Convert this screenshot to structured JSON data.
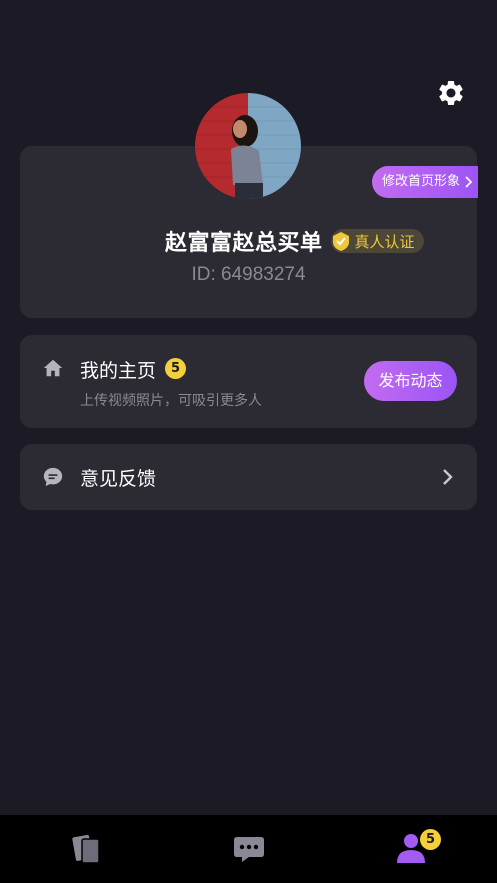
{
  "header": {
    "settings_icon": "gear-icon"
  },
  "profile": {
    "avatar_icon": "user-photo",
    "edit_label": "修改首页形象",
    "name": "赵富富赵总买单",
    "verify_label": "真人认证",
    "id_text": "ID: 64983274"
  },
  "home_card": {
    "icon": "home-icon",
    "title": "我的主页",
    "badge": "5",
    "subtitle": "上传视频照片，可吸引更多人",
    "publish_label": "发布动态"
  },
  "feedback": {
    "icon": "chat-bubble-icon",
    "label": "意见反馈"
  },
  "tabbar": {
    "items": [
      {
        "icon": "cards-icon",
        "active": false
      },
      {
        "icon": "message-icon",
        "active": false
      },
      {
        "icon": "user-icon",
        "active": true
      }
    ],
    "me_badge": "5"
  },
  "colors": {
    "background": "#1c1a24",
    "card": "#2c2a33",
    "accent_start": "#c26cf0",
    "accent_end": "#9b54f5",
    "badge": "#f5cf38",
    "muted_text": "#8a8894"
  }
}
